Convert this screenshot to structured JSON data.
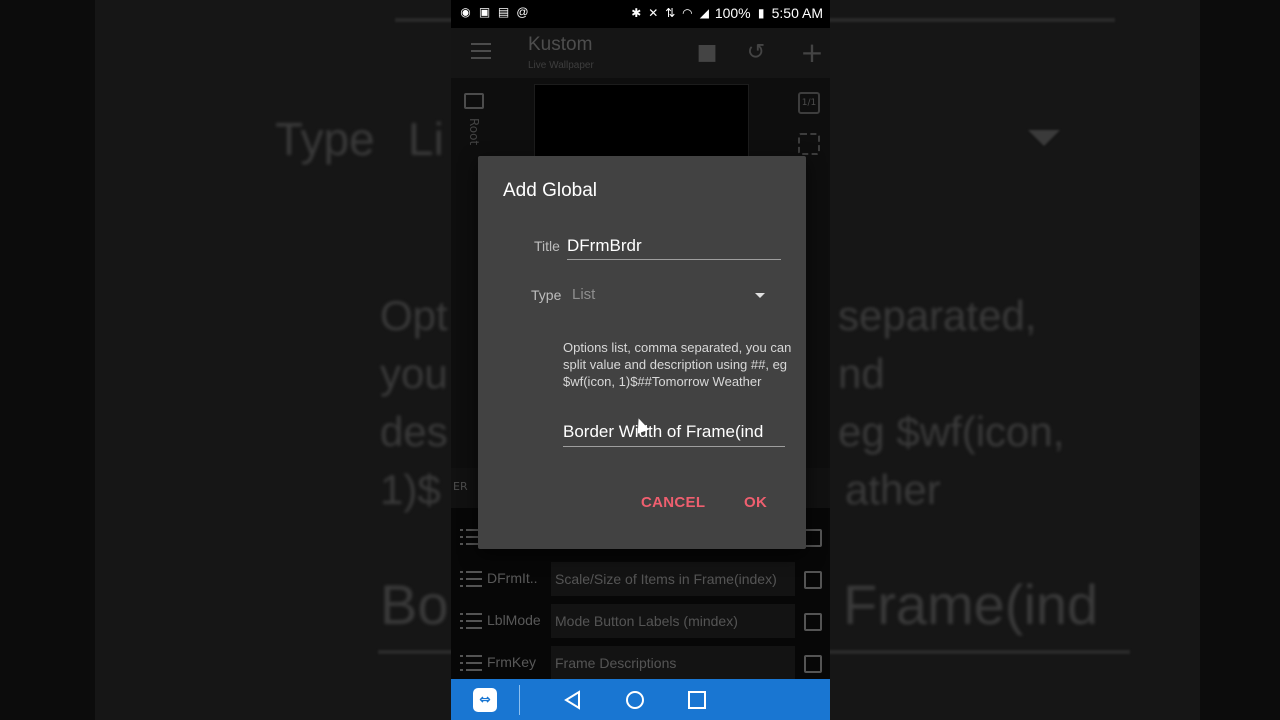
{
  "background": {
    "ghost_type": "Type",
    "ghost_list": "Li",
    "ghost_line1": "Opt",
    "ghost_line1_right": "separated,",
    "ghost_line2": "you",
    "ghost_line2_right": "nd",
    "ghost_line3": "des",
    "ghost_line3_right": "eg $wf(icon,",
    "ghost_line4": "1)$",
    "ghost_line4_right": "ather",
    "ghost_big_left": "Bo",
    "ghost_big_right": "Frame(ind"
  },
  "status_bar": {
    "battery": "100%",
    "time": "5:50 AM"
  },
  "app_bar": {
    "title": "Kustom",
    "subtitle": "Live Wallpaper"
  },
  "editor": {
    "root_label": "Root",
    "aspect_label": "1/1"
  },
  "tab_strip": {
    "partial_label": "ER"
  },
  "globals_list": [
    {
      "key": "DFrmIt..",
      "description": "Scale/Size of Items in Frame(index)"
    },
    {
      "key": "LblMode",
      "description": "Mode Button Labels (mindex)"
    },
    {
      "key": "FrmKey",
      "description": "Frame Descriptions"
    }
  ],
  "dialog": {
    "title": "Add Global",
    "title_label": "Title",
    "title_value": "DFrmBrdr",
    "type_label": "Type",
    "type_value": "List",
    "help_text": "Options list, comma separated, you can split value and description using ##, eg $wf(icon, 1)$##Tomorrow Weather",
    "options_value": "Border Width of Frame(ind",
    "cancel_label": "CANCEL",
    "ok_label": "OK"
  },
  "colors": {
    "accent": "#ef5f6f",
    "nav_bar": "#1976d2",
    "dialog_bg": "#424242"
  }
}
